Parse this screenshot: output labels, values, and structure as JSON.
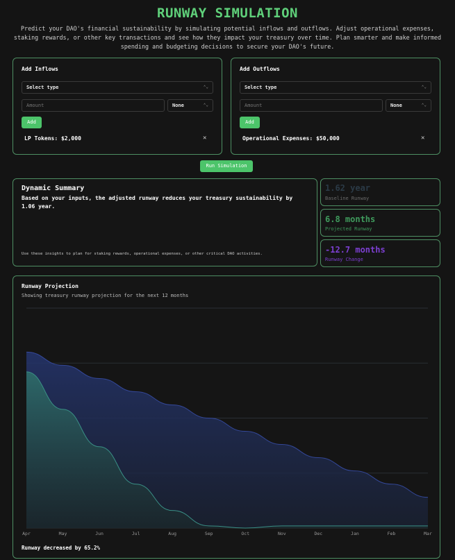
{
  "header": {
    "title": "RUNWAY SIMULATION",
    "subtitle": "Predict your DAO's financial sustainability by simulating potential inflows and outflows. Adjust operational expenses, staking rewards, or other key transactions and see how they impact your treasury over time. Plan smarter and make informed spending and budgeting decisions to secure your DAO's future."
  },
  "inflows": {
    "title": "Add Inflows",
    "type_value": "Select type",
    "amount_placeholder": "Amount",
    "unit_value": "None",
    "add_label": "Add",
    "entries": [
      {
        "label": "LP Tokens: $2,000"
      }
    ]
  },
  "outflows": {
    "title": "Add Outflows",
    "type_value": "Select type",
    "amount_placeholder": "Amount",
    "unit_value": "None",
    "add_label": "Add",
    "entries": [
      {
        "label": "Operational Expenses: $50,000"
      }
    ]
  },
  "run_button": "Run Simulation",
  "summary": {
    "title": "Dynamic Summary",
    "text_prefix": "Based on your inputs, the adjusted runway reduces your treasury sustainability by ",
    "text_value": "1.06 year.",
    "footnote": "Use these insights to plan for staking rewards, operational expenses, or other critical DAO activities."
  },
  "stats": [
    {
      "value": "1.62 year",
      "label": "Baseline Runway",
      "value_color": "#2b3a46",
      "label_color": "#6b6b6b"
    },
    {
      "value": "6.8 months",
      "label": "Projected Runway",
      "value_color": "#3f9a5c",
      "label_color": "#3f9a5c"
    },
    {
      "value": "-12.7 months",
      "label": "Runway Change",
      "value_color": "#7c3fd1",
      "label_color": "#7c3fd1"
    }
  ],
  "projection": {
    "title": "Runway Projection",
    "subtitle": "Showing treasury runway projection for the next 12 months",
    "footer": "Runway decreased by 65.2%"
  },
  "colors": {
    "accent": "#4cc46a",
    "baseline_series": "#34489a",
    "projected_series": "#3a8f86"
  },
  "chart_data": {
    "type": "area",
    "categories": [
      "Apr",
      "May",
      "Jun",
      "Jul",
      "Aug",
      "Sep",
      "Oct",
      "Nov",
      "Dec",
      "Jan",
      "Feb",
      "Mar"
    ],
    "ylim": [
      0,
      100
    ],
    "grid": "horizontal",
    "series": [
      {
        "values": [
          80,
          74,
          68,
          62,
          56,
          50,
          44,
          38,
          32,
          26,
          20,
          14
        ]
      },
      {
        "values": [
          71,
          54,
          37,
          20,
          8,
          1,
          0,
          1,
          1,
          1,
          1,
          1
        ]
      }
    ]
  }
}
